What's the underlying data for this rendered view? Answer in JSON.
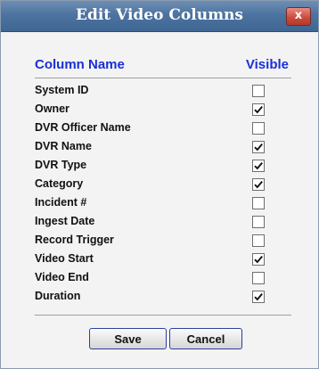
{
  "dialog": {
    "title": "Edit Video Columns",
    "close_label": "x"
  },
  "table": {
    "header_name": "Column Name",
    "header_visible": "Visible",
    "rows": [
      {
        "label": "System ID",
        "visible": false
      },
      {
        "label": "Owner",
        "visible": true
      },
      {
        "label": "DVR Officer Name",
        "visible": false
      },
      {
        "label": "DVR Name",
        "visible": true
      },
      {
        "label": "DVR Type",
        "visible": true
      },
      {
        "label": "Category",
        "visible": true
      },
      {
        "label": "Incident #",
        "visible": false
      },
      {
        "label": "Ingest Date",
        "visible": false
      },
      {
        "label": "Record Trigger",
        "visible": false
      },
      {
        "label": "Video Start",
        "visible": true
      },
      {
        "label": "Video End",
        "visible": false
      },
      {
        "label": "Duration",
        "visible": true
      }
    ]
  },
  "buttons": {
    "save_label": "Save",
    "cancel_label": "Cancel"
  },
  "colors": {
    "title_bar": "#4d73a0",
    "header_text": "#1a2fd6",
    "close_button": "#c9493b"
  }
}
